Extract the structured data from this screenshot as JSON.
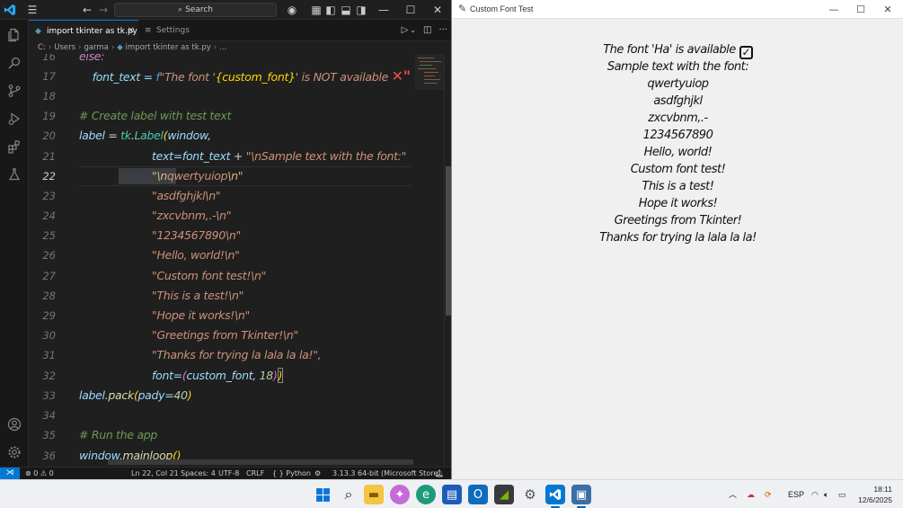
{
  "vscode": {
    "search_placeholder": "Search",
    "tabs": [
      {
        "label": "import tkinter as tk.py",
        "close": "✕"
      },
      {
        "label": "Settings"
      }
    ],
    "breadcrumb": [
      "C:",
      "Users",
      "garma",
      "import tkinter as tk.py",
      "..."
    ],
    "status": {
      "problems": "⊗ 0 ⚠ 0",
      "position": "Ln 22, Col 21",
      "spaces": "Spaces: 4",
      "encoding": "UTF-8",
      "eol": "CRLF",
      "language": "{ } Python",
      "interpreter": "3.13.3 64-bit (Microsoft Store)"
    },
    "line_numbers": [
      "16",
      "17",
      "18",
      "19",
      "20",
      "21",
      "22",
      "23",
      "24",
      "25",
      "26",
      "27",
      "28",
      "29",
      "30",
      "31",
      "32",
      "33",
      "34",
      "35",
      "36"
    ],
    "current_line": "22",
    "code": {
      "l16": "else:",
      "l17_a": "    font_text = ",
      "l17_f": "f",
      "l17_b": "\"The font '",
      "l17_c": "{custom_font}",
      "l17_d": "' is NOT available ",
      "l17_e": "✕\"",
      "l19": "# Create label with test text",
      "l20_a": "label",
      "l20_b": " = ",
      "l20_c": "tk",
      "l20_d": ".",
      "l20_e": "Label",
      "l20_f": "(",
      "l20_g": "window,",
      "l21_a": "text=font_text",
      "l21_b": " + ",
      "l21_c": "\"\\nSample text with the font:\"",
      "l22_a": "\"\\n",
      "l22_b": "qwertyuiop",
      "l22_c": "\\n\"",
      "l23": "\"asdfghjkl\\n\"",
      "l24": "\"zxcvbnm,.-\\n\"",
      "l25": "\"1234567890\\n\"",
      "l26": "\"Hello, world!\\n\"",
      "l27": "\"Custom font test!\\n\"",
      "l28": "\"This is a test!\\n\"",
      "l29": "\"Hope it works!\\n\"",
      "l30": "\"Greetings from Tkinter!\\n\"",
      "l31": "\"Thanks for trying la lala la la!\",",
      "l32_a": "font=",
      "l32_b": "(",
      "l32_c": "custom_font",
      "l32_d": ", ",
      "l32_e": "18",
      "l32_f": ")",
      "l32_g": ")",
      "l33_a": "label",
      "l33_b": ".",
      "l33_c": "pack",
      "l33_d": "(",
      "l33_e": "pady=",
      "l33_f": "40",
      "l33_g": ")",
      "l35": "# Run the app",
      "l36_a": "window",
      "l36_b": ".",
      "l36_c": "mainloop",
      "l36_d": "()"
    }
  },
  "tk_window": {
    "title": "Custom Font Test",
    "lines": [
      "The font 'Ha' is available",
      "Sample text with the font:",
      "qwertyuiop",
      "asdfghjkl",
      "zxcvbnm,.-",
      "1234567890",
      "Hello, world!",
      "Custom font test!",
      "This is a test!",
      "Hope it works!",
      "Greetings from Tkinter!",
      "Thanks for trying la lala la la!"
    ],
    "check": "✓"
  },
  "taskbar": {
    "language": "ESP",
    "time": "18:11",
    "date": "12/6/2025"
  },
  "colors": {
    "accent": "#0078d4",
    "error_red": "#f14c4c",
    "string_orange": "#ce9178",
    "comment_green": "#6a9955"
  }
}
